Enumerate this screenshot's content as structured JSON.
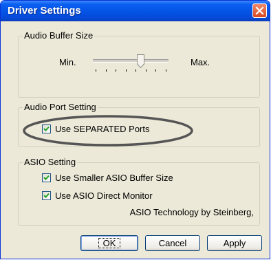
{
  "window": {
    "title": "Driver Settings",
    "close_icon": "close-icon"
  },
  "audio_buffer": {
    "group_label": "Audio Buffer Size",
    "min_label": "Min.",
    "max_label": "Max.",
    "slider_position": 0.65,
    "tick_count": 8
  },
  "audio_port": {
    "group_label": "Audio Port Setting",
    "options": [
      {
        "label": "Use SEPARATED Ports",
        "checked": true
      }
    ]
  },
  "asio": {
    "group_label": "ASIO Setting",
    "options": [
      {
        "label": "Use Smaller ASIO Buffer Size",
        "checked": true
      },
      {
        "label": "Use ASIO Direct Monitor",
        "checked": true
      }
    ],
    "credit": "ASIO Technology by Steinberg,"
  },
  "buttons": {
    "ok": "OK",
    "cancel": "Cancel",
    "apply": "Apply"
  },
  "colors": {
    "titlebar": "#0453e5",
    "dialog_bg": "#ece9d8",
    "check": "#21a121",
    "highlight_ellipse": "#555555"
  }
}
